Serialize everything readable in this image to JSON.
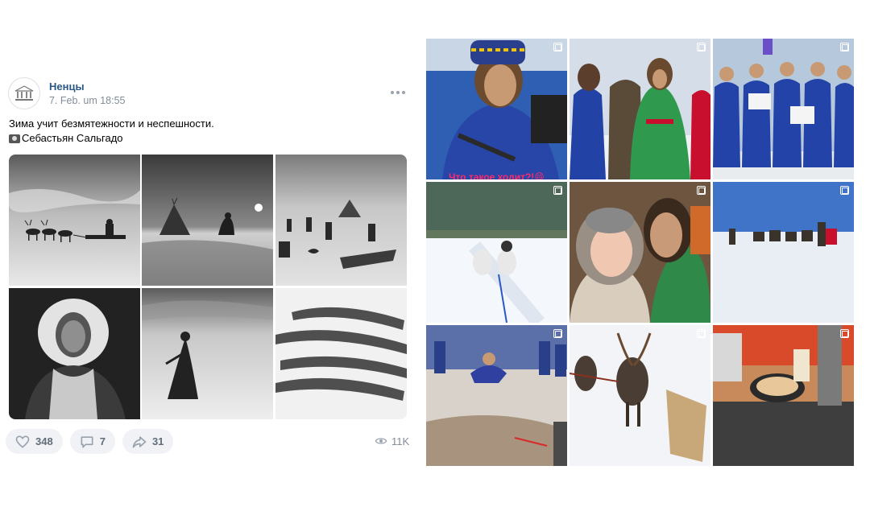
{
  "post": {
    "author": "Ненцы",
    "date": "7. Feb. um 18:55",
    "text_line1": "Зима учит безмятежности и неспешности.",
    "text_line2": "Себастьян Сальгадо",
    "likes": "348",
    "comments": "7",
    "reposts": "31",
    "views": "11K",
    "photos": [
      {
        "name": "photo-reindeer-sled",
        "icon": "reindeer-sled"
      },
      {
        "name": "photo-chum-tent",
        "icon": "tent-sunset"
      },
      {
        "name": "photo-camp-sleds",
        "icon": "camp"
      },
      {
        "name": "photo-child-portrait",
        "icon": "portrait"
      },
      {
        "name": "photo-walker-snow",
        "icon": "walker"
      },
      {
        "name": "photo-reindeer-herd",
        "icon": "herd"
      }
    ]
  },
  "gallery": {
    "items": [
      {
        "name": "gallery-man-blue-parka",
        "caption": "Что такое ходит?!😄"
      },
      {
        "name": "gallery-group-costumes",
        "caption": ""
      },
      {
        "name": "gallery-award-group",
        "caption": ""
      },
      {
        "name": "gallery-dog-sled",
        "caption": ""
      },
      {
        "name": "gallery-couple-selfie",
        "caption": ""
      },
      {
        "name": "gallery-reindeer-field",
        "caption": ""
      },
      {
        "name": "gallery-competition",
        "caption": ""
      },
      {
        "name": "gallery-reindeer-harness",
        "caption": ""
      },
      {
        "name": "gallery-stove-cooking",
        "caption": ""
      }
    ]
  },
  "colors": {
    "link": "#2a5885",
    "muted": "#818c99",
    "button_bg": "#f0f2f5"
  }
}
